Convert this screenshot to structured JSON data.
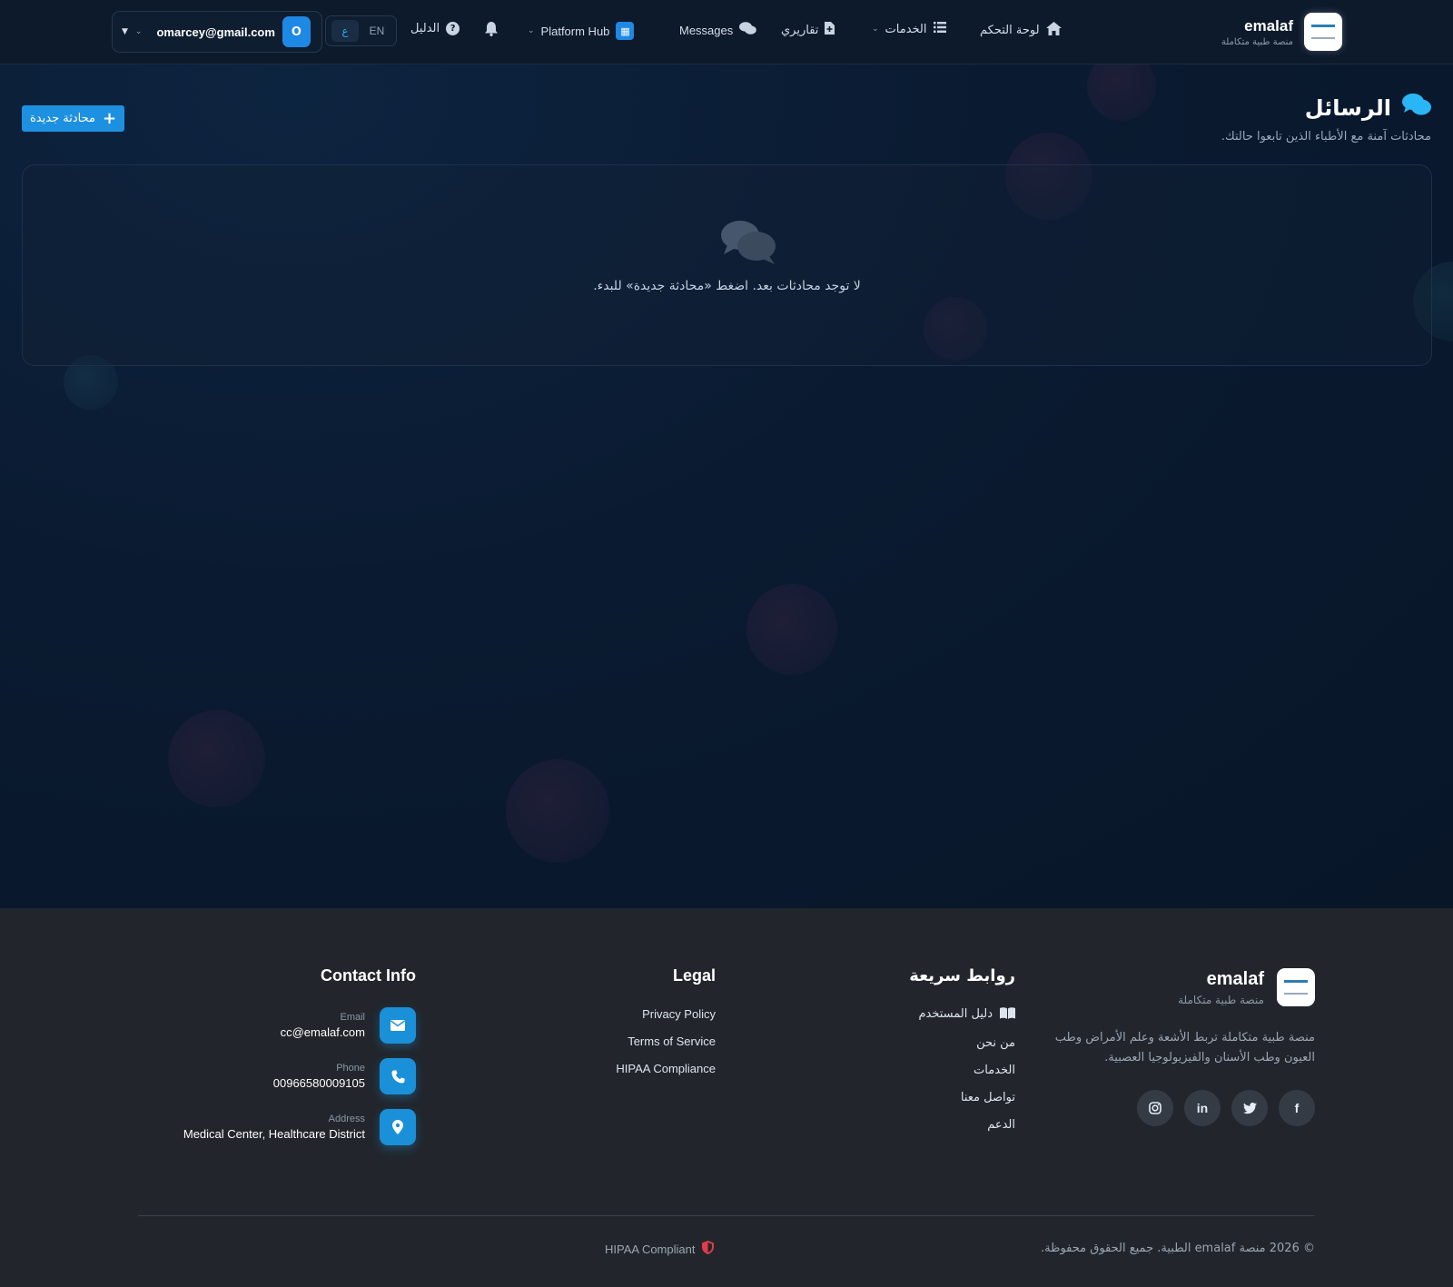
{
  "navbar": {
    "brand_name": "emalaf",
    "brand_sub": "منصة طبية متكاملة",
    "items": [
      {
        "label": "لوحة التحكم",
        "icon": "home-icon"
      },
      {
        "label": "الخدمات",
        "icon": "list-icon"
      },
      {
        "label": "تقاريري",
        "icon": "file-icon"
      },
      {
        "label": "Messages",
        "icon": "comments-icon"
      },
      {
        "label": "Platform Hub",
        "icon": "hub-icon"
      },
      {
        "label": "الدليل",
        "icon": "help-icon"
      }
    ],
    "lang_en": "EN",
    "lang_ar": "ع",
    "user_email": "omarcey@gmail.com",
    "user_initial": "O"
  },
  "page": {
    "title": "الرسائل",
    "subtitle": "محادثات آمنة مع الأطباء الذين تابعوا حالتك.",
    "new_chat_label": "محادثة جديدة",
    "empty_text": "لا توجد محادثات بعد. اضغط «محادثة جديدة» للبدء."
  },
  "footer": {
    "brand_name": "emalaf",
    "brand_sub": "منصة طبية متكاملة",
    "description": "منصة طبية متكاملة تربط الأشعة وعلم الأمراض وطب العيون وطب الأسنان والفيزيولوجيا العصبية.",
    "socials": [
      "facebook-icon",
      "twitter-icon",
      "linkedin-icon",
      "instagram-icon"
    ],
    "quick_links": {
      "title": "روابط سريعة",
      "items": [
        "دليل المستخدم",
        "من نحن",
        "الخدمات",
        "تواصل معنا",
        "الدعم"
      ]
    },
    "legal": {
      "title": "Legal",
      "items": [
        "Privacy Policy",
        "Terms of Service",
        "HIPAA Compliance"
      ]
    },
    "contact": {
      "title": "Contact Info",
      "email_label": "Email",
      "email": "cc@emalaf.com",
      "phone_label": "Phone",
      "phone": "00966580009105",
      "address_label": "Address",
      "address": "Medical Center, Healthcare District"
    },
    "copyright": "© 2026 منصة emalaf الطبية. جميع الحقوق محفوظة.",
    "hipaa": "HIPAA Compliant"
  },
  "colors": {
    "accent": "#1e90e0",
    "navbar_bg": "#0d1a2c",
    "page_bg": "#0a1a30",
    "footer_bg": "#22262c"
  }
}
